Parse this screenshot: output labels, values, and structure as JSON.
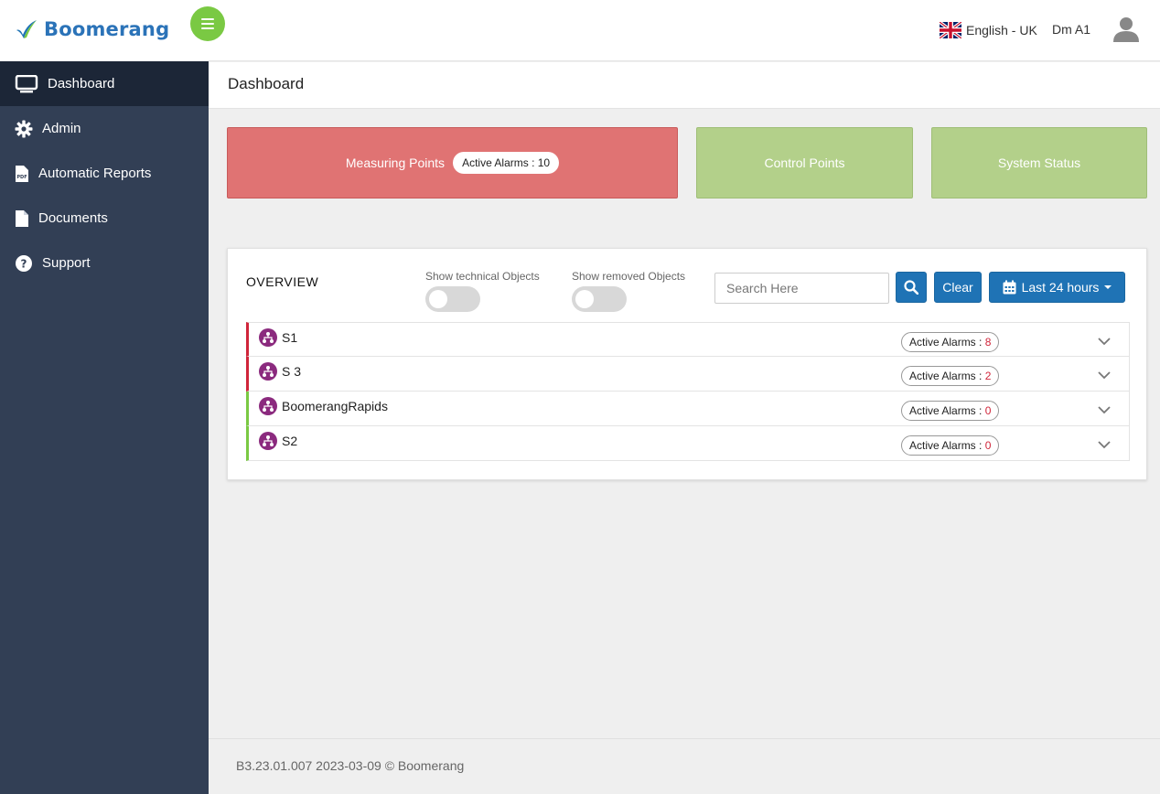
{
  "brand": {
    "name": "Boomerang"
  },
  "colors": {
    "sidebar": "#323f55",
    "sidebar_active": "#1c2637",
    "accent_green": "#7ac943",
    "primary_blue": "#1f73b5",
    "alarm_red": "#e07373",
    "ok_green": "#b3d08a"
  },
  "sidebar": {
    "items": [
      {
        "label": "Dashboard",
        "icon": "monitor-icon",
        "active": true
      },
      {
        "label": "Admin",
        "icon": "gear-icon"
      },
      {
        "label": "Automatic Reports",
        "icon": "pdf-file-icon"
      },
      {
        "label": "Documents",
        "icon": "document-icon"
      },
      {
        "label": "Support",
        "icon": "question-circle-icon"
      }
    ]
  },
  "topbar": {
    "language": "English - UK",
    "flag": "uk-flag-icon",
    "user": "Dm A1",
    "avatar_icon": "user-avatar-icon"
  },
  "page": {
    "title": "Dashboard"
  },
  "tiles": {
    "measuring": {
      "label": "Measuring Points",
      "badge": "Active Alarms : 10",
      "status": "alarm"
    },
    "control": {
      "label": "Control Points",
      "status": "ok"
    },
    "system": {
      "label": "System Status",
      "status": "ok"
    }
  },
  "overview": {
    "title": "OVERVIEW",
    "toggle_technical": {
      "label": "Show technical Objects",
      "on": false
    },
    "toggle_removed": {
      "label": "Show removed Objects",
      "on": false
    },
    "search_placeholder": "Search Here",
    "clear_label": "Clear",
    "range_label": "Last 24 hours",
    "badge_prefix": "Active Alarms : ",
    "rows": [
      {
        "name": "S1",
        "alarms": "8",
        "status": "alarm"
      },
      {
        "name": "S 3",
        "alarms": "2",
        "status": "alarm"
      },
      {
        "name": "BoomerangRapids",
        "alarms": "0",
        "status": "ok"
      },
      {
        "name": "S2",
        "alarms": "0",
        "status": "ok"
      }
    ]
  },
  "footer": {
    "text": "B3.23.01.007 2023-03-09 © Boomerang"
  }
}
